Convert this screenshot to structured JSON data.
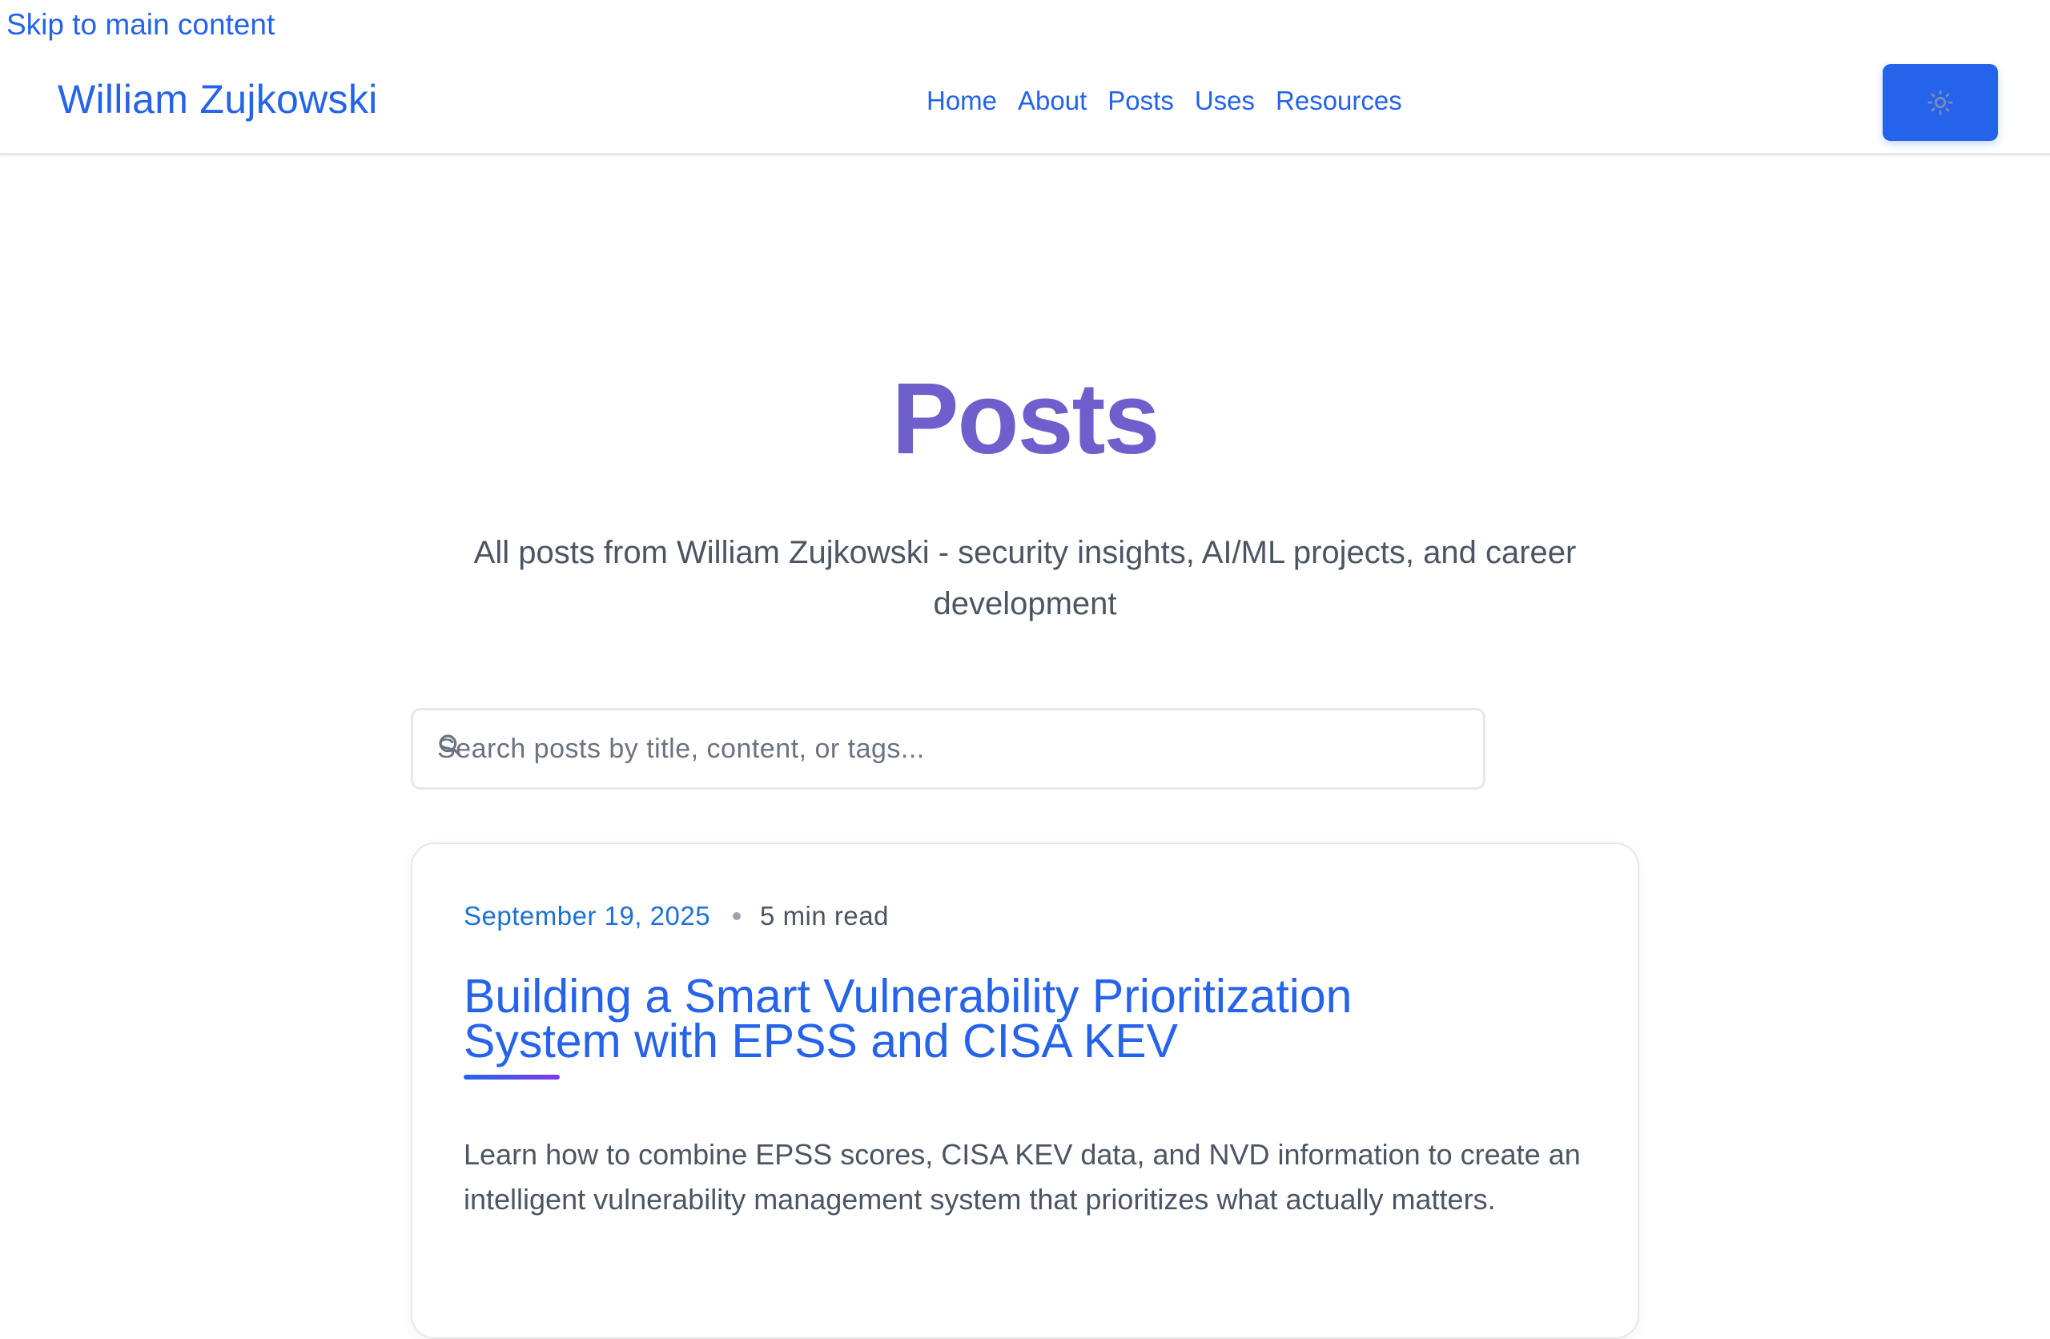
{
  "skip_link": "Skip to main content",
  "header": {
    "brand": "William Zujkowski",
    "nav": [
      "Home",
      "About",
      "Posts",
      "Uses",
      "Resources"
    ],
    "theme_toggle_icon": "sun-icon"
  },
  "main": {
    "title": "Posts",
    "description": "All posts from William Zujkowski - security insights, AI/ML projects, and career development",
    "search": {
      "placeholder": "Search posts by title, content, or tags...",
      "value": "",
      "icon": "search-icon"
    },
    "posts": [
      {
        "date": "September 19, 2025",
        "read_time": "5 min read",
        "title": "Building a Smart Vulnerability Prioritization System with EPSS and CISA KEV",
        "excerpt": "Learn how to combine EPSS scores, CISA KEV data, and NVD information to create an intelligent vulnerability management system that prioritizes what actually matters."
      }
    ]
  },
  "colors": {
    "accent": "#2563eb",
    "title": "#6f5fcc",
    "date": "#1d70d6",
    "text_muted": "#4b5563",
    "border": "#e5e7eb"
  }
}
